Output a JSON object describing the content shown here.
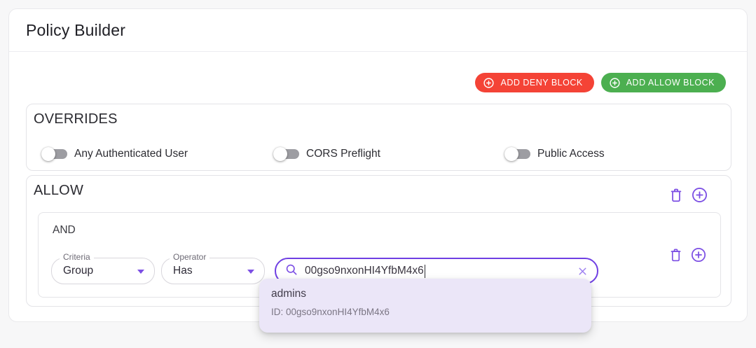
{
  "header": {
    "title": "Policy Builder"
  },
  "toolbar": {
    "add_deny": {
      "label": "ADD DENY BLOCK",
      "color": "#f44336"
    },
    "add_allow": {
      "label": "ADD ALLOW BLOCK",
      "color": "#4caf50"
    }
  },
  "overrides": {
    "title": "OVERRIDES",
    "toggles": [
      {
        "label": "Any Authenticated User",
        "state": "off"
      },
      {
        "label": "CORS Preflight",
        "state": "off"
      },
      {
        "label": "Public Access",
        "state": "off"
      }
    ]
  },
  "allow": {
    "title": "ALLOW",
    "rule": {
      "logic": "AND",
      "criteria": {
        "label": "Criteria",
        "value": "Group"
      },
      "operator": {
        "label": "Operator",
        "value": "Has"
      },
      "search": {
        "value": "00gso9nxonHI4YfbM4x6"
      }
    }
  },
  "suggestion": {
    "name": "admins",
    "id": "ID: 00gso9nxonHI4YfbM4x6"
  },
  "colors": {
    "deny_red": "#f44336",
    "allow_green": "#4caf50",
    "accent_purple": "#7c4fe4",
    "focus_border": "#6f3fe3",
    "suggestion_bg": "#ebe6f8",
    "toggle_track": "#9d9da2"
  }
}
